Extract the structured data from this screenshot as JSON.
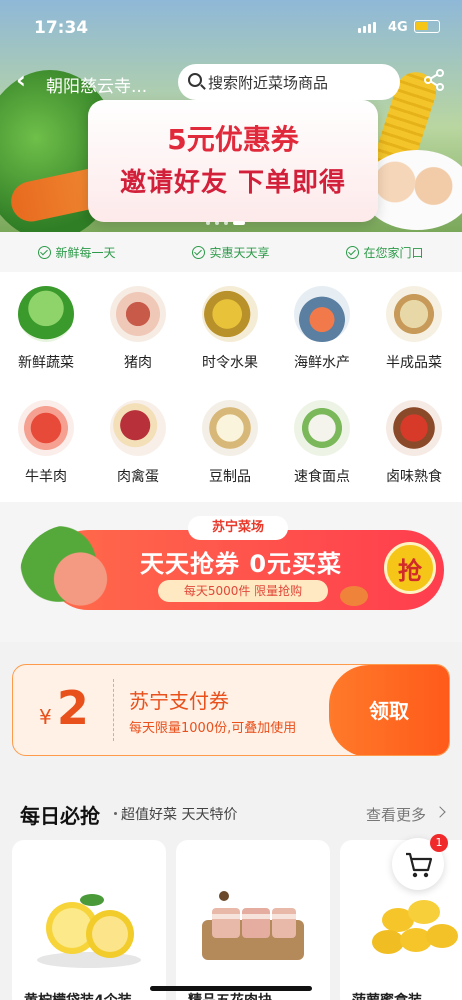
{
  "status_bar": {
    "time": "17:34",
    "network": "4G"
  },
  "nav": {
    "location": "朝阳慈云寺...",
    "search_placeholder": "搜索附近菜场商品"
  },
  "hero": {
    "line1": "5元优惠券",
    "line2": "邀请好友 下单即得",
    "carousel_count": 4,
    "carousel_active": 4
  },
  "taglines": [
    "新鲜每一天",
    "实惠天天享",
    "在您家门口"
  ],
  "categories": [
    {
      "label": "新鲜蔬菜",
      "icon": "vegetables-icon"
    },
    {
      "label": "猪肉",
      "icon": "pork-icon"
    },
    {
      "label": "时令水果",
      "icon": "fruit-icon"
    },
    {
      "label": "海鲜水产",
      "icon": "seafood-icon"
    },
    {
      "label": "半成品菜",
      "icon": "prepared-food-icon"
    },
    {
      "label": "牛羊肉",
      "icon": "beef-lamb-icon"
    },
    {
      "label": "肉禽蛋",
      "icon": "meat-egg-icon"
    },
    {
      "label": "豆制品",
      "icon": "tofu-icon"
    },
    {
      "label": "速食面点",
      "icon": "noodles-icon"
    },
    {
      "label": "卤味熟食",
      "icon": "deli-icon"
    }
  ],
  "promo": {
    "brand": "苏宁菜场",
    "title": "天天抢券 0元买菜",
    "subtitle": "每天5000件 限量抢购",
    "grab": "抢"
  },
  "coupon": {
    "currency": "¥",
    "amount": "2",
    "title": "苏宁支付券",
    "desc": "每天限量1000份,可叠加使用",
    "button": "领取"
  },
  "daily": {
    "title": "每日必抢",
    "subtitle": "超值好菜 天天特价",
    "more": "查看更多",
    "products": [
      {
        "name": "黄柠檬袋装4个装"
      },
      {
        "name": "精品五花肉块"
      },
      {
        "name": "菠萝蜜盒装"
      }
    ]
  },
  "cart": {
    "count": "1"
  },
  "colors": {
    "accent_red": "#e02a3b",
    "accent_orange": "#ff5a1a",
    "green": "#2b9a48"
  }
}
